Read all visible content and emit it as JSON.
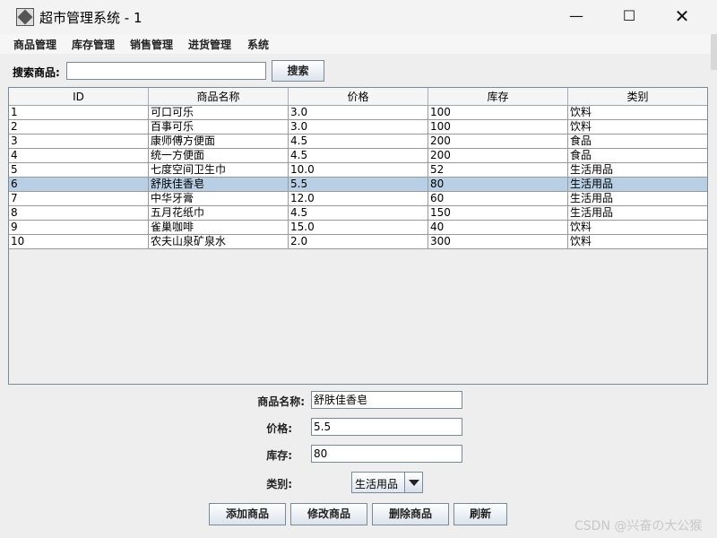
{
  "window": {
    "title": "超市管理系统 - 1",
    "controls": {
      "minimize": "—",
      "maximize": "☐",
      "close": "✕"
    }
  },
  "menu": [
    "商品管理",
    "库存管理",
    "销售管理",
    "进货管理",
    "系统"
  ],
  "search": {
    "label": "搜索商品:",
    "value": "",
    "button": "搜索"
  },
  "table": {
    "columns": [
      "ID",
      "商品名称",
      "价格",
      "库存",
      "类别"
    ],
    "selected_row": 5,
    "rows": [
      [
        "1",
        "可口可乐",
        "3.0",
        "100",
        "饮料"
      ],
      [
        "2",
        "百事可乐",
        "3.0",
        "100",
        "饮料"
      ],
      [
        "3",
        "康师傅方便面",
        "4.5",
        "200",
        "食品"
      ],
      [
        "4",
        "统一方便面",
        "4.5",
        "200",
        "食品"
      ],
      [
        "5",
        "七度空间卫生巾",
        "10.0",
        "52",
        "生活用品"
      ],
      [
        "6",
        "舒肤佳香皂",
        "5.5",
        "80",
        "生活用品"
      ],
      [
        "7",
        "中华牙膏",
        "12.0",
        "60",
        "生活用品"
      ],
      [
        "8",
        "五月花纸巾",
        "4.5",
        "150",
        "生活用品"
      ],
      [
        "9",
        "雀巢咖啡",
        "15.0",
        "40",
        "饮料"
      ],
      [
        "10",
        "农夫山泉矿泉水",
        "2.0",
        "300",
        "饮料"
      ]
    ]
  },
  "form": {
    "name_label": "商品名称:",
    "name_value": "舒肤佳香皂",
    "price_label": "价格:",
    "price_value": "5.5",
    "stock_label": "库存:",
    "stock_value": "80",
    "category_label": "类别:",
    "category_value": "生活用品"
  },
  "actions": {
    "add": "添加商品",
    "edit": "修改商品",
    "delete": "删除商品",
    "refresh": "刷新"
  },
  "watermark": "CSDN @兴奋の大公猴"
}
